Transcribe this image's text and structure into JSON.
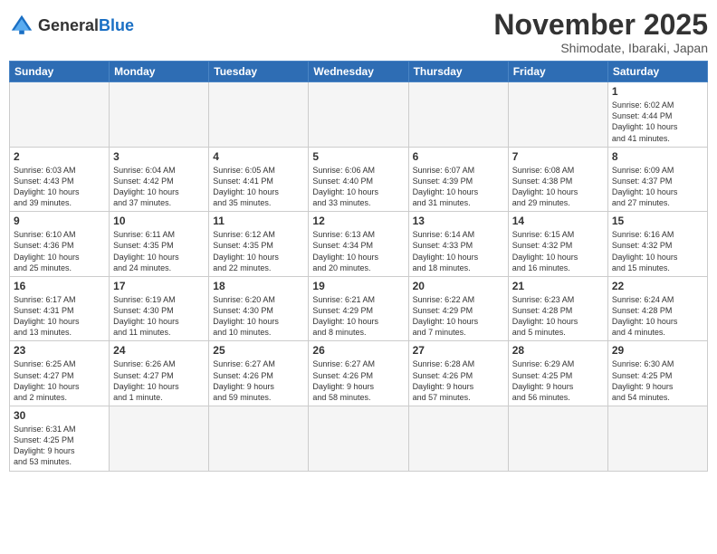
{
  "header": {
    "logo_general": "General",
    "logo_blue": "Blue",
    "month_title": "November 2025",
    "subtitle": "Shimodate, Ibaraki, Japan"
  },
  "weekdays": [
    "Sunday",
    "Monday",
    "Tuesday",
    "Wednesday",
    "Thursday",
    "Friday",
    "Saturday"
  ],
  "weeks": [
    [
      {
        "day": "",
        "info": ""
      },
      {
        "day": "",
        "info": ""
      },
      {
        "day": "",
        "info": ""
      },
      {
        "day": "",
        "info": ""
      },
      {
        "day": "",
        "info": ""
      },
      {
        "day": "",
        "info": ""
      },
      {
        "day": "1",
        "info": "Sunrise: 6:02 AM\nSunset: 4:44 PM\nDaylight: 10 hours\nand 41 minutes."
      }
    ],
    [
      {
        "day": "2",
        "info": "Sunrise: 6:03 AM\nSunset: 4:43 PM\nDaylight: 10 hours\nand 39 minutes."
      },
      {
        "day": "3",
        "info": "Sunrise: 6:04 AM\nSunset: 4:42 PM\nDaylight: 10 hours\nand 37 minutes."
      },
      {
        "day": "4",
        "info": "Sunrise: 6:05 AM\nSunset: 4:41 PM\nDaylight: 10 hours\nand 35 minutes."
      },
      {
        "day": "5",
        "info": "Sunrise: 6:06 AM\nSunset: 4:40 PM\nDaylight: 10 hours\nand 33 minutes."
      },
      {
        "day": "6",
        "info": "Sunrise: 6:07 AM\nSunset: 4:39 PM\nDaylight: 10 hours\nand 31 minutes."
      },
      {
        "day": "7",
        "info": "Sunrise: 6:08 AM\nSunset: 4:38 PM\nDaylight: 10 hours\nand 29 minutes."
      },
      {
        "day": "8",
        "info": "Sunrise: 6:09 AM\nSunset: 4:37 PM\nDaylight: 10 hours\nand 27 minutes."
      }
    ],
    [
      {
        "day": "9",
        "info": "Sunrise: 6:10 AM\nSunset: 4:36 PM\nDaylight: 10 hours\nand 25 minutes."
      },
      {
        "day": "10",
        "info": "Sunrise: 6:11 AM\nSunset: 4:35 PM\nDaylight: 10 hours\nand 24 minutes."
      },
      {
        "day": "11",
        "info": "Sunrise: 6:12 AM\nSunset: 4:35 PM\nDaylight: 10 hours\nand 22 minutes."
      },
      {
        "day": "12",
        "info": "Sunrise: 6:13 AM\nSunset: 4:34 PM\nDaylight: 10 hours\nand 20 minutes."
      },
      {
        "day": "13",
        "info": "Sunrise: 6:14 AM\nSunset: 4:33 PM\nDaylight: 10 hours\nand 18 minutes."
      },
      {
        "day": "14",
        "info": "Sunrise: 6:15 AM\nSunset: 4:32 PM\nDaylight: 10 hours\nand 16 minutes."
      },
      {
        "day": "15",
        "info": "Sunrise: 6:16 AM\nSunset: 4:32 PM\nDaylight: 10 hours\nand 15 minutes."
      }
    ],
    [
      {
        "day": "16",
        "info": "Sunrise: 6:17 AM\nSunset: 4:31 PM\nDaylight: 10 hours\nand 13 minutes."
      },
      {
        "day": "17",
        "info": "Sunrise: 6:19 AM\nSunset: 4:30 PM\nDaylight: 10 hours\nand 11 minutes."
      },
      {
        "day": "18",
        "info": "Sunrise: 6:20 AM\nSunset: 4:30 PM\nDaylight: 10 hours\nand 10 minutes."
      },
      {
        "day": "19",
        "info": "Sunrise: 6:21 AM\nSunset: 4:29 PM\nDaylight: 10 hours\nand 8 minutes."
      },
      {
        "day": "20",
        "info": "Sunrise: 6:22 AM\nSunset: 4:29 PM\nDaylight: 10 hours\nand 7 minutes."
      },
      {
        "day": "21",
        "info": "Sunrise: 6:23 AM\nSunset: 4:28 PM\nDaylight: 10 hours\nand 5 minutes."
      },
      {
        "day": "22",
        "info": "Sunrise: 6:24 AM\nSunset: 4:28 PM\nDaylight: 10 hours\nand 4 minutes."
      }
    ],
    [
      {
        "day": "23",
        "info": "Sunrise: 6:25 AM\nSunset: 4:27 PM\nDaylight: 10 hours\nand 2 minutes."
      },
      {
        "day": "24",
        "info": "Sunrise: 6:26 AM\nSunset: 4:27 PM\nDaylight: 10 hours\nand 1 minute."
      },
      {
        "day": "25",
        "info": "Sunrise: 6:27 AM\nSunset: 4:26 PM\nDaylight: 9 hours\nand 59 minutes."
      },
      {
        "day": "26",
        "info": "Sunrise: 6:27 AM\nSunset: 4:26 PM\nDaylight: 9 hours\nand 58 minutes."
      },
      {
        "day": "27",
        "info": "Sunrise: 6:28 AM\nSunset: 4:26 PM\nDaylight: 9 hours\nand 57 minutes."
      },
      {
        "day": "28",
        "info": "Sunrise: 6:29 AM\nSunset: 4:25 PM\nDaylight: 9 hours\nand 56 minutes."
      },
      {
        "day": "29",
        "info": "Sunrise: 6:30 AM\nSunset: 4:25 PM\nDaylight: 9 hours\nand 54 minutes."
      }
    ],
    [
      {
        "day": "30",
        "info": "Sunrise: 6:31 AM\nSunset: 4:25 PM\nDaylight: 9 hours\nand 53 minutes."
      },
      {
        "day": "",
        "info": ""
      },
      {
        "day": "",
        "info": ""
      },
      {
        "day": "",
        "info": ""
      },
      {
        "day": "",
        "info": ""
      },
      {
        "day": "",
        "info": ""
      },
      {
        "day": "",
        "info": ""
      }
    ]
  ]
}
